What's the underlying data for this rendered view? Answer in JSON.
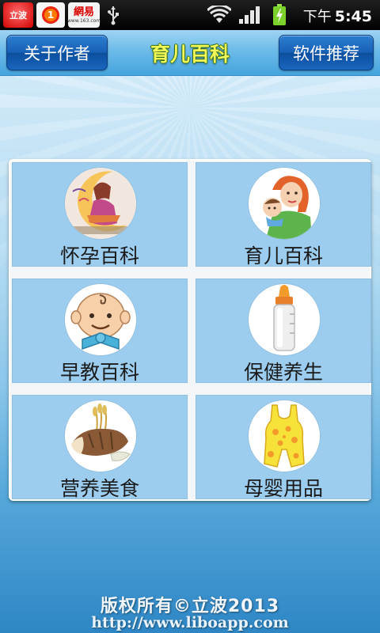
{
  "status_bar": {
    "notifications": [
      {
        "name": "libo-app-icon",
        "label": "立波"
      },
      {
        "name": "weibo-notification-icon",
        "badge": "1"
      },
      {
        "name": "netease-icon",
        "label": "網易",
        "sublabel": "www.163.com"
      },
      {
        "name": "usb-icon"
      }
    ],
    "system_icons": [
      "wifi-icon",
      "signal-icon",
      "battery-charging-icon"
    ],
    "time_period": "下午",
    "time": "5:45"
  },
  "header": {
    "left_button": "关于作者",
    "title": "育儿百科",
    "right_button": "软件推荐"
  },
  "grid": [
    {
      "label": "怀孕百科",
      "icon": "pregnancy-icon"
    },
    {
      "label": "育儿百科",
      "icon": "mother-baby-icon"
    },
    {
      "label": "早教百科",
      "icon": "baby-face-icon"
    },
    {
      "label": "保健养生",
      "icon": "baby-bottle-icon"
    },
    {
      "label": "营养美食",
      "icon": "bread-food-icon"
    },
    {
      "label": "母婴用品",
      "icon": "baby-romper-icon"
    }
  ],
  "footer": {
    "copyright": "版权所有©立波2013",
    "url": "http://www.liboapp.com"
  },
  "colors": {
    "header_button": "#1760b5",
    "title_text": "#f4f95a",
    "cell_background": "#9ccdef",
    "panel_background": "#f3f6f8"
  }
}
